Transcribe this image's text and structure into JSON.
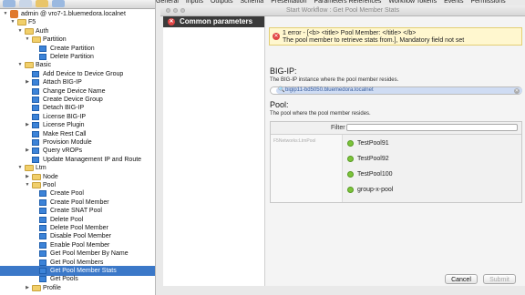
{
  "menu": [
    "General",
    "Inputs",
    "Outputs",
    "Schema",
    "Presentation",
    "Parameters References",
    "Workflow Tokens",
    "Events",
    "Permissions"
  ],
  "tree": [
    {
      "label": "admin @ vro7-1.bluemedora.localnet",
      "icon": "server-icon",
      "toggle": "▼",
      "depth": 0
    },
    {
      "label": "F5",
      "icon": "folder-icon",
      "toggle": "▼",
      "depth": 1
    },
    {
      "label": "Auth",
      "icon": "folder-icon",
      "toggle": "▼",
      "depth": 2
    },
    {
      "label": "Partition",
      "icon": "folder-icon",
      "toggle": "▼",
      "depth": 3
    },
    {
      "label": "Create Partition",
      "icon": "workflow-icon",
      "toggle": "",
      "depth": 4
    },
    {
      "label": "Delete Partition",
      "icon": "workflow-icon",
      "toggle": "",
      "depth": 4
    },
    {
      "label": "Basic",
      "icon": "folder-icon",
      "toggle": "▼",
      "depth": 2
    },
    {
      "label": "Add Device to Device Group",
      "icon": "workflow-icon",
      "toggle": "",
      "depth": 3
    },
    {
      "label": "Attach BIG-IP",
      "icon": "workflow-icon",
      "toggle": "▶",
      "depth": 3
    },
    {
      "label": "Change Device Name",
      "icon": "workflow-icon",
      "toggle": "",
      "depth": 3
    },
    {
      "label": "Create Device Group",
      "icon": "workflow-icon",
      "toggle": "",
      "depth": 3
    },
    {
      "label": "Detach BIG-IP",
      "icon": "workflow-icon",
      "toggle": "",
      "depth": 3
    },
    {
      "label": "License BIG-IP",
      "icon": "workflow-icon",
      "toggle": "",
      "depth": 3
    },
    {
      "label": "License Plugin",
      "icon": "workflow-icon",
      "toggle": "▶",
      "depth": 3
    },
    {
      "label": "Make Rest Call",
      "icon": "workflow-icon",
      "toggle": "",
      "depth": 3
    },
    {
      "label": "Provision Module",
      "icon": "workflow-icon",
      "toggle": "",
      "depth": 3
    },
    {
      "label": "Query vROPs",
      "icon": "workflow-icon",
      "toggle": "▶",
      "depth": 3
    },
    {
      "label": "Update Management IP and Route",
      "icon": "workflow-icon",
      "toggle": "",
      "depth": 3
    },
    {
      "label": "Ltm",
      "icon": "folder-icon",
      "toggle": "▼",
      "depth": 2
    },
    {
      "label": "Node",
      "icon": "folder-icon",
      "toggle": "▶",
      "depth": 3
    },
    {
      "label": "Pool",
      "icon": "folder-icon",
      "toggle": "▼",
      "depth": 3
    },
    {
      "label": "Create Pool",
      "icon": "workflow-icon",
      "toggle": "",
      "depth": 4
    },
    {
      "label": "Create Pool Member",
      "icon": "workflow-icon",
      "toggle": "",
      "depth": 4
    },
    {
      "label": "Create SNAT Pool",
      "icon": "workflow-icon",
      "toggle": "",
      "depth": 4
    },
    {
      "label": "Delete Pool",
      "icon": "workflow-icon",
      "toggle": "",
      "depth": 4
    },
    {
      "label": "Delete Pool Member",
      "icon": "workflow-icon",
      "toggle": "",
      "depth": 4
    },
    {
      "label": "Disable Pool Member",
      "icon": "workflow-icon",
      "toggle": "",
      "depth": 4
    },
    {
      "label": "Enable Pool Member",
      "icon": "workflow-icon",
      "toggle": "",
      "depth": 4
    },
    {
      "label": "Get Pool Member By Name",
      "icon": "workflow-icon",
      "toggle": "",
      "depth": 4
    },
    {
      "label": "Get Pool Members",
      "icon": "workflow-icon",
      "toggle": "",
      "depth": 4
    },
    {
      "label": "Get Pool Member Stats",
      "icon": "workflow-icon",
      "toggle": "",
      "depth": 4,
      "selected": true
    },
    {
      "label": "Get Pools",
      "icon": "workflow-icon",
      "toggle": "",
      "depth": 4
    },
    {
      "label": "Profile",
      "icon": "folder-icon",
      "toggle": "▶",
      "depth": 3
    }
  ],
  "dialog": {
    "title": "Start Workflow : Get Pool Member Stats",
    "nav_item": "Common parameters",
    "error_line1": "1 error - [<b> <title> Pool Member: </title> </b>",
    "error_line2": "The pool member to retrieve stats from.], Mandatory field not set",
    "bigip_title": "BIG-IP:",
    "bigip_desc": "The BIG-IP instance where the pool member resides.",
    "bigip_value": "bigip11-bd5050.bluemedora.localnet",
    "pool_title": "Pool:",
    "pool_desc": "The pool where the pool member resides.",
    "filter_label": "Filter",
    "filter_value": "",
    "pool_path": "F5Networks:LtmPool",
    "pools": [
      "TestPool91",
      "TestPool92",
      "TestPool100",
      "group-x-pool"
    ],
    "cancel_label": "Cancel",
    "submit_label": "Submit"
  }
}
